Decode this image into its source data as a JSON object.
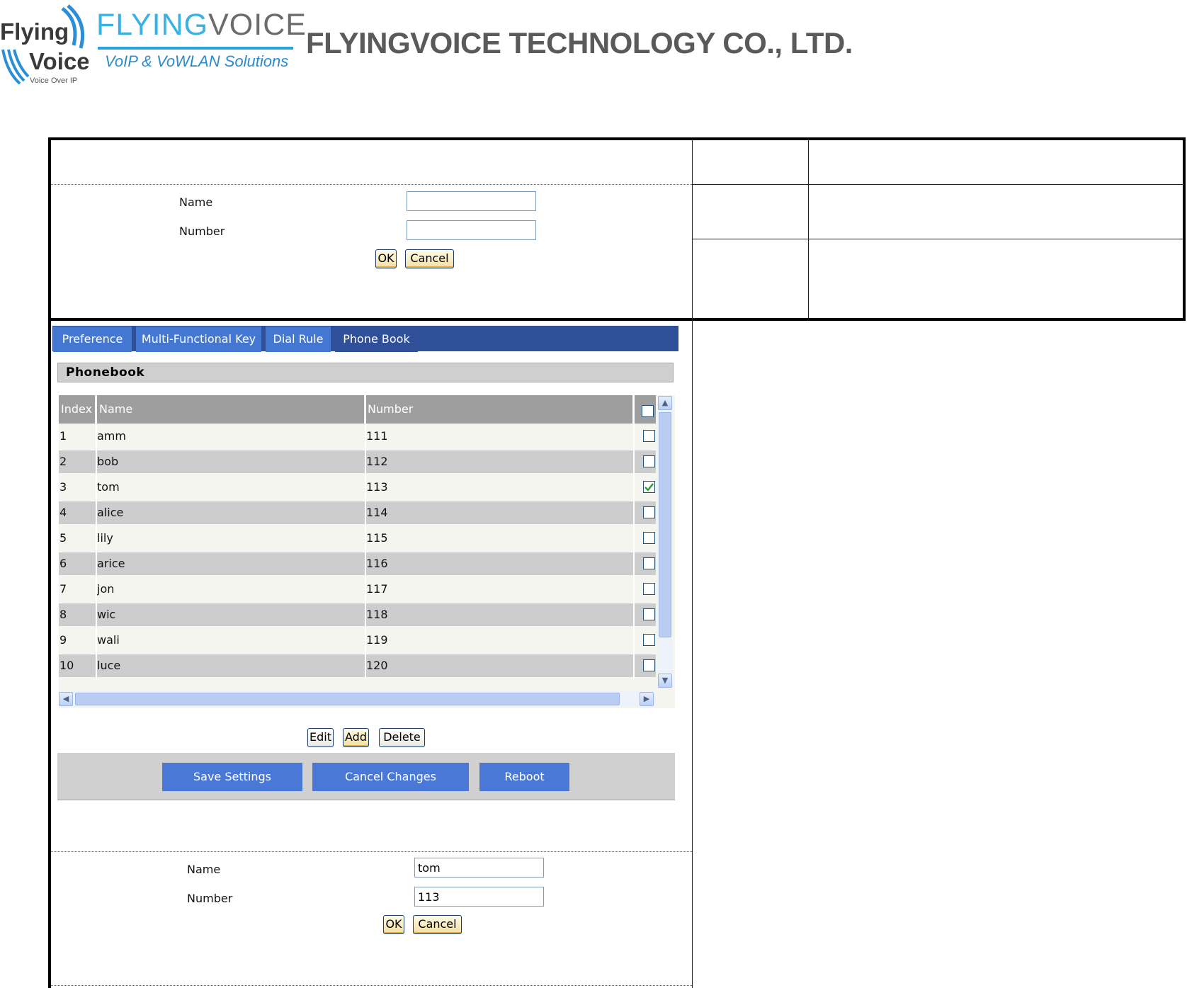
{
  "header": {
    "logo_flying": "Flying",
    "logo_voice": "Voice",
    "logo_tagline": "Voice Over IP",
    "brand_part1": "FLYING",
    "brand_part2": "VOICE",
    "brand_sub": "VoIP & VoWLAN Solutions",
    "company": "FLYINGVOICE TECHNOLOGY CO., LTD."
  },
  "form_top": {
    "name_label": "Name",
    "number_label": "Number",
    "name_value": "",
    "number_value": "",
    "ok_label": "OK",
    "cancel_label": "Cancel"
  },
  "tabs": [
    {
      "label": "Preference"
    },
    {
      "label": "Multi-Functional Key"
    },
    {
      "label": "Dial Rule"
    },
    {
      "label": "Phone Book",
      "active": true
    }
  ],
  "phonebook": {
    "title": "Phonebook",
    "columns": [
      "Index",
      "Name",
      "Number"
    ],
    "rows": [
      {
        "index": "1",
        "name": "amm",
        "number": "111",
        "checked": false
      },
      {
        "index": "2",
        "name": "bob",
        "number": "112",
        "checked": false
      },
      {
        "index": "3",
        "name": "tom",
        "number": "113",
        "checked": true
      },
      {
        "index": "4",
        "name": "alice",
        "number": "114",
        "checked": false
      },
      {
        "index": "5",
        "name": "lily",
        "number": "115",
        "checked": false
      },
      {
        "index": "6",
        "name": "arice",
        "number": "116",
        "checked": false
      },
      {
        "index": "7",
        "name": "jon",
        "number": "117",
        "checked": false
      },
      {
        "index": "8",
        "name": "wic",
        "number": "118",
        "checked": false
      },
      {
        "index": "9",
        "name": "wali",
        "number": "119",
        "checked": false
      },
      {
        "index": "10",
        "name": "luce",
        "number": "120",
        "checked": false
      }
    ],
    "edit_label": "Edit",
    "add_label": "Add",
    "delete_label": "Delete"
  },
  "actions": {
    "save_label": "Save Settings",
    "cancel_label": "Cancel Changes",
    "reboot_label": "Reboot"
  },
  "form_bottom": {
    "name_label": "Name",
    "number_label": "Number",
    "name_value": "tom",
    "number_value": "113",
    "ok_label": "OK",
    "cancel_label": "Cancel"
  },
  "colors": {
    "tab_bar": "#2f4f98",
    "tab": "#4477d2",
    "action_button": "#4a78d6",
    "brand_blue": "#39b1e6",
    "company_gray": "#5a5a5a"
  },
  "icons": [
    "scroll-up-icon",
    "scroll-down-icon",
    "scroll-left-icon",
    "scroll-right-icon",
    "check-icon",
    "flying-voice-logo-icon"
  ]
}
